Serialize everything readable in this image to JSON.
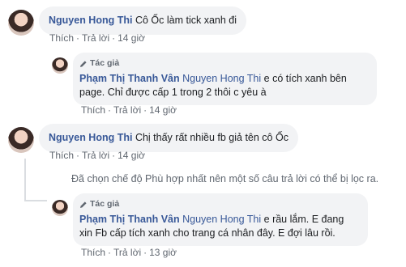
{
  "comments": [
    {
      "author": "Nguyen Hong Thi",
      "text": "Cô Ốc làm tick xanh đi",
      "actions": {
        "like": "Thích",
        "reply": "Trả lời",
        "time": "14 giờ"
      },
      "reply": {
        "badge": "Tác giả",
        "author": "Phạm Thị Thanh Vân",
        "mention": "Nguyen Hong Thi",
        "text_line1": " e có tích xanh bên",
        "text_line2": "page. Chỉ được cấp 1 trong 2 thôi c yêu à",
        "actions": {
          "like": "Thích",
          "reply": "Trả lời",
          "time": "14 giờ"
        }
      }
    },
    {
      "author": "Nguyen Hong Thi",
      "text": "Chị thấy rất nhiều fb giả tên cô Ốc",
      "actions": {
        "like": "Thích",
        "reply": "Trả lời",
        "time": "14 giờ"
      },
      "filter_note": "Đã chọn chế độ Phù hợp nhất nên một số câu trả lời có thể bị lọc ra.",
      "reply": {
        "badge": "Tác giả",
        "author": "Phạm Thị Thanh Vân",
        "mention": "Nguyen Hong Thi",
        "text_line1": " e rầu lắm. E đang",
        "text_line2": "xin Fb cấp tích xanh cho trang cá nhân đây. E đợi lâu rồi.",
        "actions": {
          "like": "Thích",
          "reply": "Trả lời",
          "time": "13 giờ"
        }
      }
    }
  ],
  "separator": "·",
  "icons": {
    "avatar": "user-avatar",
    "author_badge": "pencil-icon"
  }
}
